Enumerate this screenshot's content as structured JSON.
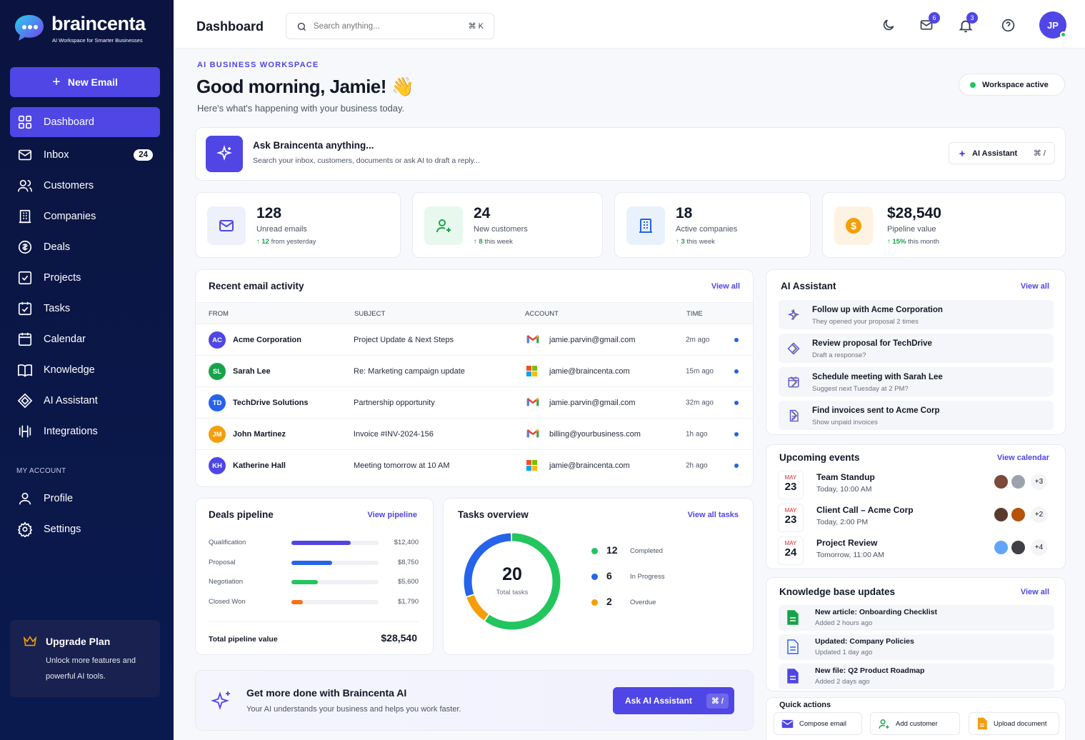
{
  "brand": {
    "name": "braincenta",
    "tagline": "AI Workspace for Smarter Businesses"
  },
  "sidebar": {
    "new_email_label": "New Email",
    "items": [
      {
        "label": "Dashboard"
      },
      {
        "label": "Inbox",
        "badge": "24"
      },
      {
        "label": "Customers"
      },
      {
        "label": "Companies"
      },
      {
        "label": "Deals"
      },
      {
        "label": "Projects"
      },
      {
        "label": "Tasks"
      },
      {
        "label": "Calendar"
      },
      {
        "label": "Knowledge"
      },
      {
        "label": "AI Assistant"
      },
      {
        "label": "Integrations"
      }
    ],
    "account_label": "MY ACCOUNT",
    "account_items": [
      {
        "label": "Profile"
      },
      {
        "label": "Settings"
      }
    ],
    "upgrade": {
      "title": "Upgrade Plan",
      "text_line1": "Unlock more features and",
      "text_line2": "powerful AI tools."
    }
  },
  "header": {
    "title": "Dashboard",
    "search_placeholder": "Search anything...",
    "search_shortcut": "⌘ K",
    "mail_count": "6",
    "notif_count": "3",
    "avatar_initials": "JP"
  },
  "hero": {
    "eyebrow": "AI BUSINESS WORKSPACE",
    "greeting": "Good morning, Jamie! 👋",
    "subtitle": "Here's what's happening with your business today.",
    "status": "Workspace active"
  },
  "ask": {
    "title": "Ask Braincenta anything...",
    "subtitle": "Search your inbox, customers, documents or ask AI to draft a reply...",
    "button": "AI Assistant",
    "shortcut": "⌘ /"
  },
  "stats": [
    {
      "value": "128",
      "label": "Unread emails",
      "delta": "12",
      "delta_text": "from yesterday"
    },
    {
      "value": "24",
      "label": "New customers",
      "delta": "8",
      "delta_text": "this week"
    },
    {
      "value": "18",
      "label": "Active companies",
      "delta": "3",
      "delta_text": "this week"
    },
    {
      "value": "$28,540",
      "label": "Pipeline value",
      "delta": "15%",
      "delta_text": "this month"
    }
  ],
  "emails": {
    "title": "Recent email activity",
    "view_all": "View all",
    "columns": [
      "FROM",
      "SUBJECT",
      "ACCOUNT",
      "TIME"
    ],
    "rows": [
      {
        "initials": "AC",
        "color": "#4f46e5",
        "from": "Acme Corporation",
        "subject": "Project Update & Next Steps",
        "provider": "gmail",
        "account": "jamie.parvin@gmail.com",
        "time": "2m ago"
      },
      {
        "initials": "SL",
        "color": "#16a34a",
        "from": "Sarah Lee",
        "subject": "Re: Marketing campaign update",
        "provider": "microsoft",
        "account": "jamie@braincenta.com",
        "time": "15m ago"
      },
      {
        "initials": "TD",
        "color": "#2563eb",
        "from": "TechDrive Solutions",
        "subject": "Partnership opportunity",
        "provider": "gmail",
        "account": "jamie.parvin@gmail.com",
        "time": "32m ago"
      },
      {
        "initials": "JM",
        "color": "#f59e0b",
        "from": "John Martinez",
        "subject": "Invoice #INV-2024-156",
        "provider": "gmail",
        "account": "billing@yourbusiness.com",
        "time": "1h ago"
      },
      {
        "initials": "KH",
        "color": "#4f46e5",
        "from": "Katherine Hall",
        "subject": "Meeting tomorrow at 10 AM",
        "provider": "microsoft",
        "account": "jamie@braincenta.com",
        "time": "2h ago"
      }
    ]
  },
  "assistant": {
    "title": "AI Assistant",
    "view_all": "View all",
    "items": [
      {
        "title": "Follow up with Acme Corporation",
        "sub": "They opened your proposal 2 times"
      },
      {
        "title": "Review proposal for TechDrive",
        "sub": "Draft a response?"
      },
      {
        "title": "Schedule meeting with Sarah Lee",
        "sub": "Suggest next Tuesday at 2 PM?"
      },
      {
        "title": "Find invoices sent to Acme Corp",
        "sub": "Show unpaid invoices"
      }
    ]
  },
  "events": {
    "title": "Upcoming events",
    "view_all": "View calendar",
    "items": [
      {
        "month": "MAY",
        "day": "23",
        "title": "Team Standup",
        "time": "Today, 10:00 AM",
        "more": "+3"
      },
      {
        "month": "MAY",
        "day": "23",
        "title": "Client Call – Acme Corp",
        "time": "Today, 2:00 PM",
        "more": "+2"
      },
      {
        "month": "MAY",
        "day": "24",
        "title": "Project Review",
        "time": "Tomorrow, 11:00 AM",
        "more": "+4"
      }
    ]
  },
  "knowledge": {
    "title": "Knowledge base updates",
    "view_all": "View all",
    "items": [
      {
        "title": "New article: Onboarding Checklist",
        "sub": "Added 2 hours ago",
        "color": "#16a34a"
      },
      {
        "title": "Updated: Company Policies",
        "sub": "Updated 1 day ago",
        "color": "#2563eb"
      },
      {
        "title": "New file: Q2 Product Roadmap",
        "sub": "Added 2 days ago",
        "color": "#4f46e5"
      }
    ]
  },
  "quick_actions": {
    "title": "Quick actions",
    "items": [
      {
        "label": "Compose email"
      },
      {
        "label": "Add customer"
      },
      {
        "label": "Upload document"
      }
    ]
  },
  "pipeline": {
    "title": "Deals pipeline",
    "view_all": "View pipeline",
    "stages": [
      {
        "name": "Qualification",
        "value": "$12,400",
        "fill": 0.68,
        "color": "#4f46e5"
      },
      {
        "name": "Proposal",
        "value": "$8,750",
        "fill": 0.47,
        "color": "#2563eb"
      },
      {
        "name": "Negotiation",
        "value": "$5,600",
        "fill": 0.3,
        "color": "#22c55e"
      },
      {
        "name": "Closed Won",
        "value": "$1,790",
        "fill": 0.13,
        "color": "#f97316"
      }
    ],
    "total_label": "Total pipeline value",
    "total_value": "$28,540"
  },
  "tasks": {
    "title": "Tasks overview",
    "view_all": "View all tasks",
    "total": "20",
    "total_label": "Total tasks",
    "items": [
      {
        "count": 12,
        "label": "Completed",
        "color": "#22c55e"
      },
      {
        "count": 6,
        "label": "In Progress",
        "color": "#2563eb"
      },
      {
        "count": 2,
        "label": "Overdue",
        "color": "#f59e0b"
      }
    ]
  },
  "promo": {
    "title": "Get more done with Braincenta AI",
    "subtitle": "Your AI understands your business and helps you work faster.",
    "button": "Ask AI Assistant",
    "shortcut": "⌘ /"
  }
}
